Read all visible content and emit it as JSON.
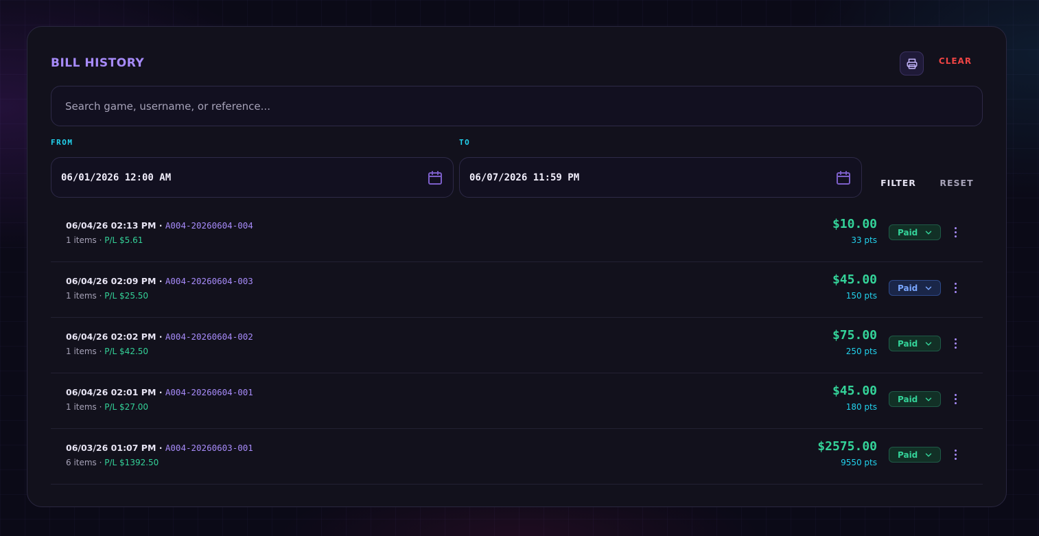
{
  "header": {
    "title": "BILL HISTORY",
    "clear_label": "CLEAR"
  },
  "search": {
    "placeholder": "Search game, username, or reference..."
  },
  "filters": {
    "from_label": "FROM",
    "to_label": "TO",
    "from_value": "06/01/2026 12:00 AM",
    "to_value": "06/07/2026 11:59 PM",
    "filter_label": "FILTER",
    "reset_label": "RESET"
  },
  "bills": [
    {
      "datetime": "06/04/26 02:13 PM",
      "sep": " · ",
      "ref": "A004-20260604-004",
      "items": "1 items",
      "dot": " · ",
      "pl": "P/L $5.61",
      "amount": "$10.00",
      "pts": "33 pts",
      "status": "Paid",
      "status_style": "green"
    },
    {
      "datetime": "06/04/26 02:09 PM",
      "sep": " · ",
      "ref": "A004-20260604-003",
      "items": "1 items",
      "dot": " · ",
      "pl": "P/L $25.50",
      "amount": "$45.00",
      "pts": "150 pts",
      "status": "Paid",
      "status_style": "blue"
    },
    {
      "datetime": "06/04/26 02:02 PM",
      "sep": " · ",
      "ref": "A004-20260604-002",
      "items": "1 items",
      "dot": " · ",
      "pl": "P/L $42.50",
      "amount": "$75.00",
      "pts": "250 pts",
      "status": "Paid",
      "status_style": "green"
    },
    {
      "datetime": "06/04/26 02:01 PM",
      "sep": " · ",
      "ref": "A004-20260604-001",
      "items": "1 items",
      "dot": " · ",
      "pl": "P/L $27.00",
      "amount": "$45.00",
      "pts": "180 pts",
      "status": "Paid",
      "status_style": "green"
    },
    {
      "datetime": "06/03/26 01:07 PM",
      "sep": " · ",
      "ref": "A004-20260603-001",
      "items": "6 items",
      "dot": " · ",
      "pl": "P/L $1392.50",
      "amount": "$2575.00",
      "pts": "9550 pts",
      "status": "Paid",
      "status_style": "green"
    }
  ],
  "icons": {
    "print": "printer-icon",
    "calendar": "calendar-icon",
    "chevron": "chevron-down-icon",
    "kebab": "more-vertical-icon"
  },
  "colors": {
    "accent_purple": "#a78bfa",
    "accent_cyan": "#22d3ee",
    "positive_green": "#34d399",
    "danger_red": "#ef4444",
    "panel_bg": "#12111c"
  }
}
